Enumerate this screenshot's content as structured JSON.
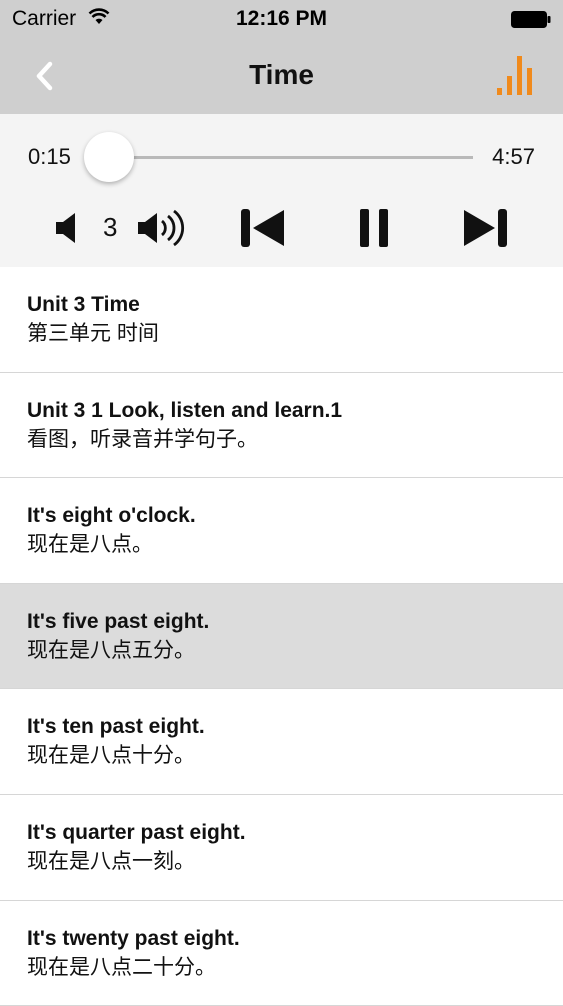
{
  "status_bar": {
    "carrier": "Carrier",
    "time": "12:16 PM"
  },
  "nav": {
    "title": "Time",
    "back_icon": "chevron-left-icon",
    "levels_icon": "audio-levels-icon",
    "accent_color": "#f08a1c"
  },
  "player": {
    "current_time": "0:15",
    "duration": "4:57",
    "progress": 0.05,
    "volume_level": "3",
    "progress_color": "#1aa3d9"
  },
  "list": {
    "selected_index": 3,
    "items": [
      {
        "en": "Unit 3 Time",
        "zh": "第三单元 时间"
      },
      {
        "en": "Unit 3 1 Look, listen and learn.1",
        "zh": "看图，听录音并学句子。"
      },
      {
        "en": "It's eight o'clock.",
        "zh": "现在是八点。"
      },
      {
        "en": "It's five past eight.",
        "zh": "现在是八点五分。"
      },
      {
        "en": "It's ten past eight.",
        "zh": "现在是八点十分。"
      },
      {
        "en": "It's quarter past eight.",
        "zh": "现在是八点一刻。"
      },
      {
        "en": "It's twenty past eight.",
        "zh": "现在是八点二十分。"
      }
    ]
  }
}
